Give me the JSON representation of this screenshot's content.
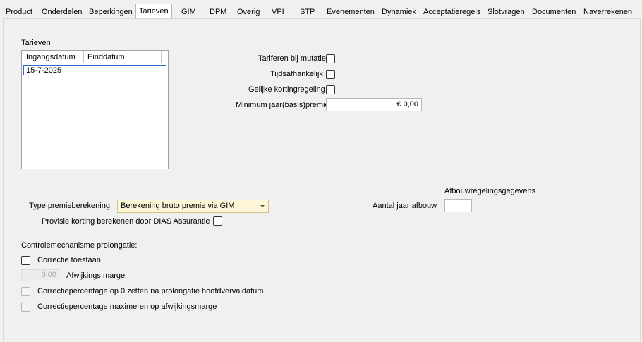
{
  "tabs": [
    {
      "label": "Product"
    },
    {
      "label": "Onderdelen"
    },
    {
      "label": "Beperkingen"
    },
    {
      "label": "Tarieven"
    },
    {
      "label": "GIM"
    },
    {
      "label": "DPM"
    },
    {
      "label": "Overig"
    },
    {
      "label": "VPI"
    },
    {
      "label": "STP"
    },
    {
      "label": "Evenementen"
    },
    {
      "label": "Dynamiek"
    },
    {
      "label": "Acceptatieregels"
    },
    {
      "label": "Slotvragen"
    },
    {
      "label": "Documenten"
    },
    {
      "label": "Naverrekenen"
    }
  ],
  "active_tab": "Tarieven",
  "tarieven": {
    "group_label": "Tarieven",
    "columns": [
      "Ingangsdatum",
      "Einddatum"
    ],
    "rows": [
      [
        "15-7-2025",
        ""
      ]
    ]
  },
  "options": {
    "tariferen_label": "Tariferen bij mutatie",
    "tijdsafhankelijk_label": "Tijdsafhankelijk",
    "gelijke_label": "Gelijke kortingregeling",
    "minimum_label": "Minimum jaar(basis)premie",
    "minimum_value": "€ 0,00"
  },
  "premie": {
    "type_label": "Type premieberekening",
    "type_value": "Berekening bruto premie via GIM",
    "provisie_label": "Provisie korting berekenen door DIAS Assurantie"
  },
  "afbouw": {
    "group_label": "Afbouwregelingsgegevens",
    "aantal_label": "Aantal jaar afbouw",
    "aantal_value": ""
  },
  "controle": {
    "heading": "Controlemechanisme prolongatie:",
    "correctie_label": "Correctie toestaan",
    "marge_value": "0.00",
    "marge_label": "Afwijkings marge",
    "nul_label": "Correctiepercentage op 0 zetten na prolongatie hoofdvervaldatum",
    "max_label": "Correctiepercentage maximeren op afwijkingsmarge"
  }
}
